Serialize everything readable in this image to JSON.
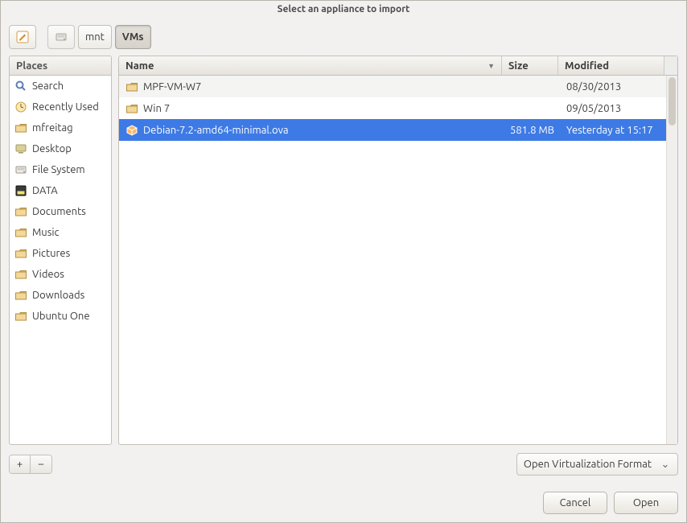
{
  "window": {
    "title": "Select an appliance to import"
  },
  "breadcrumbs": {
    "items": [
      {
        "icon": "edit",
        "label": ""
      },
      {
        "icon": "drive",
        "label": ""
      },
      {
        "icon": "",
        "label": "mnt"
      },
      {
        "icon": "",
        "label": "VMs",
        "active": true
      }
    ]
  },
  "places": {
    "header": "Places",
    "items": [
      {
        "icon": "search",
        "label": "Search"
      },
      {
        "icon": "recent",
        "label": "Recently Used"
      },
      {
        "icon": "home",
        "label": "mfreitag"
      },
      {
        "icon": "desktop",
        "label": "Desktop"
      },
      {
        "icon": "fs",
        "label": "File System"
      },
      {
        "icon": "disk",
        "label": "DATA"
      },
      {
        "icon": "folder",
        "label": "Documents"
      },
      {
        "icon": "folder",
        "label": "Music"
      },
      {
        "icon": "folder",
        "label": "Pictures"
      },
      {
        "icon": "folder",
        "label": "Videos"
      },
      {
        "icon": "folder",
        "label": "Downloads"
      },
      {
        "icon": "folder",
        "label": "Ubuntu One"
      }
    ],
    "buttons": {
      "add": "+",
      "remove": "–"
    }
  },
  "filelist": {
    "columns": {
      "name": "Name",
      "size": "Size",
      "modified": "Modified"
    },
    "sort_column": "name",
    "rows": [
      {
        "icon": "folder",
        "name": "MPF-VM-W7",
        "size": "",
        "modified": "08/30/2013",
        "selected": false
      },
      {
        "icon": "folder",
        "name": "Win 7",
        "size": "",
        "modified": "09/05/2013",
        "selected": false
      },
      {
        "icon": "package",
        "name": "Debian-7.2-amd64-minimal.ova",
        "size": "581.8 MB",
        "modified": "Yesterday at 15:17",
        "selected": true
      }
    ]
  },
  "filter": {
    "selected": "Open Virtualization Format"
  },
  "footer": {
    "cancel": "Cancel",
    "open": "Open"
  },
  "colors": {
    "selection": "#3d7ae5"
  }
}
